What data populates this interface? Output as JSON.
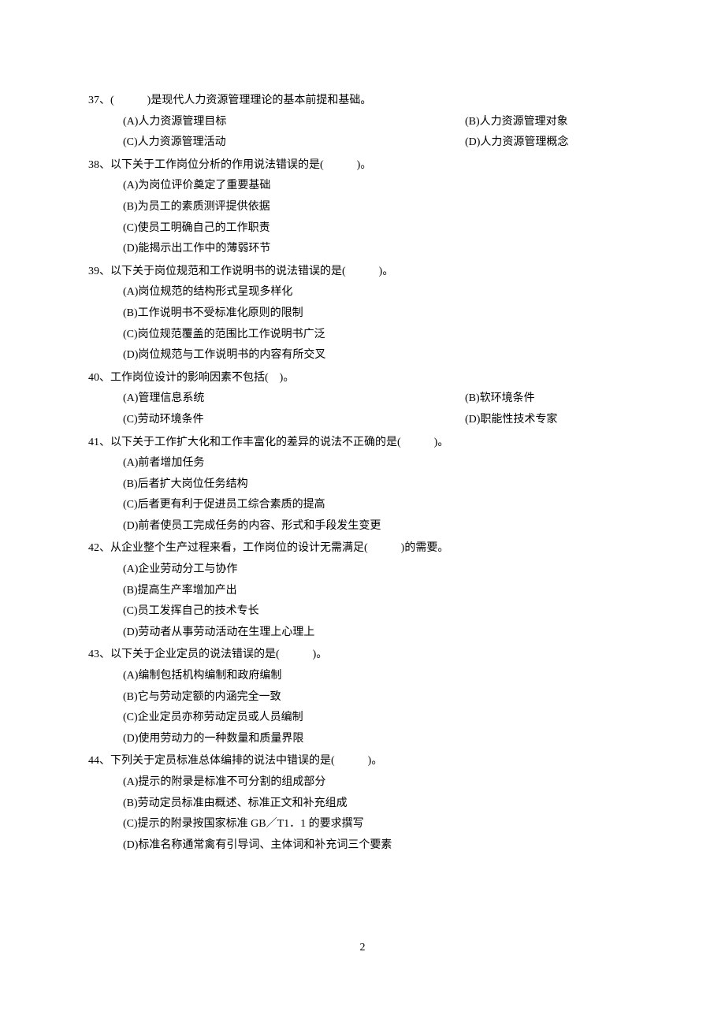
{
  "page_number": "2",
  "questions": [
    {
      "number": "37",
      "stem": "(　　　)是现代人力资源管理理论的基本前提和基础。",
      "layout": "two-col",
      "options": [
        "(A)人力资源管理目标",
        "(B)人力资源管理对象",
        "(C)人力资源管理活动",
        "(D)人力资源管理概念"
      ]
    },
    {
      "number": "38",
      "stem": "以下关于工作岗位分析的作用说法错误的是(　　　)。",
      "layout": "one-col",
      "options": [
        "(A)为岗位评价奠定了重要基础",
        "(B)为员工的素质测评提供依据",
        "(C)使员工明确自己的工作职责",
        "(D)能揭示出工作中的薄弱环节"
      ]
    },
    {
      "number": "39",
      "stem": "以下关于岗位规范和工作说明书的说法错误的是(　　　)。",
      "layout": "one-col",
      "options": [
        "(A)岗位规范的结构形式呈现多样化",
        "(B)工作说明书不受标准化原则的限制",
        "(C)岗位规范覆盖的范围比工作说明书广泛",
        "(D)岗位规范与工作说明书的内容有所交叉"
      ]
    },
    {
      "number": "40",
      "stem": "工作岗位设计的影响因素不包括(　)。",
      "layout": "two-col",
      "options": [
        "(A)管理信息系统",
        "(B)软环境条件",
        "(C)劳动环境条件",
        "(D)职能性技术专家"
      ]
    },
    {
      "number": "41",
      "stem": "以下关于工作扩大化和工作丰富化的差异的说法不正确的是(　　　)。",
      "layout": "one-col",
      "options": [
        "(A)前者增加任务",
        "(B)后者扩大岗位任务结构",
        "(C)后者更有利于促进员工综合素质的提高",
        "(D)前者使员工完成任务的内容、形式和手段发生变更"
      ]
    },
    {
      "number": "42",
      "stem": "从企业整个生产过程来看，工作岗位的设计无需满足(　　　)的需要。",
      "layout": "one-col",
      "options": [
        "(A)企业劳动分工与协作",
        "(B)提高生产率增加产出",
        "(C)员工发挥自己的技术专长",
        "(D)劳动者从事劳动活动在生理上心理上"
      ]
    },
    {
      "number": "43",
      "stem": "以下关于企业定员的说法错误的是(　　　)。",
      "layout": "one-col",
      "options": [
        "(A)编制包括机构编制和政府编制",
        "(B)它与劳动定额的内涵完全一致",
        "(C)企业定员亦称劳动定员或人员编制",
        "(D)使用劳动力的一种数量和质量界限"
      ]
    },
    {
      "number": "44",
      "stem": "下列关于定员标准总体编排的说法中错误的是(　　　)。",
      "layout": "one-col",
      "options": [
        "(A)提示的附录是标准不可分割的组成部分",
        "(B)劳动定员标准由概述、标准正文和补充组成",
        "(C)提示的附录按国家标准 GB／T1．1 的要求撰写",
        "(D)标准名称通常禽有引导词、主体词和补充词三个要素"
      ]
    }
  ]
}
